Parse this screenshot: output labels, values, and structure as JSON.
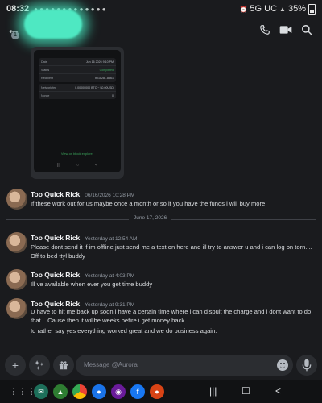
{
  "status_bar": {
    "time": "08:32",
    "signal_text": "5G UC",
    "battery": "35%"
  },
  "header": {
    "back_badge": "1",
    "icons": [
      "back-arrow-icon",
      "phone-call-icon",
      "video-camera-icon",
      "search-icon"
    ]
  },
  "screenshot": {
    "rows": [
      {
        "label": "Date",
        "value": "Jun 16 2026 9:10 PM"
      },
      {
        "label": "Status",
        "value": "Completed"
      },
      {
        "label": "Recipient",
        "value": "bc1q28...8361"
      },
      {
        "label": "Network fee",
        "value": "0.00000000 BTC ~ $0.00USD"
      },
      {
        "label": "Nonce",
        "value": "0"
      }
    ],
    "link": "View on block explorer",
    "nav": [
      "|||",
      "○",
      "<"
    ]
  },
  "messages": [
    {
      "author": "Too Quick Rick",
      "time": "06/16/2026 10:28 PM",
      "lines": [
        "If these work out for us maybe once a month or so if you have the funds i will buy more"
      ]
    },
    {
      "author": "Too Quick Rick",
      "time": "Yesterday at 12:54 AM",
      "lines": [
        "Please dont send it if im offline just send me a text on here and ill try to answer u and i can log on torn.... Off to bed ttyl buddy"
      ]
    },
    {
      "author": "Too Quick Rick",
      "time": "Yesterday at 4:03 PM",
      "lines": [
        "Ill ve available when ever you get time buddy"
      ]
    },
    {
      "author": "Too Quick Rick",
      "time": "Yesterday at 9:31 PM",
      "lines": [
        "U have to hit me back up soon i have a certain time where i can dispuit  the charge and i dont want to do that... Cause then it willbe weeks befire i get money back.",
        "Id rather say yes everything worked great and we do business again."
      ]
    }
  ],
  "date_divider": "June 17, 2026",
  "composer": {
    "placeholder": "Message @Aurora"
  },
  "nav_bar": {
    "apps": [
      "apps-grid-icon",
      "messages-app-icon",
      "gallery-app-icon",
      "chrome-app-icon",
      "signal-app-icon",
      "camera-app-icon",
      "facebook-app-icon",
      "browser-app-icon"
    ],
    "facebook_letter": "f"
  },
  "colors": {
    "background": "#1a1b1e",
    "author": "#f2f3f5",
    "timestamp": "#949ba4",
    "redaction": "#4ee8c2",
    "status_green": "#3ba55c"
  }
}
